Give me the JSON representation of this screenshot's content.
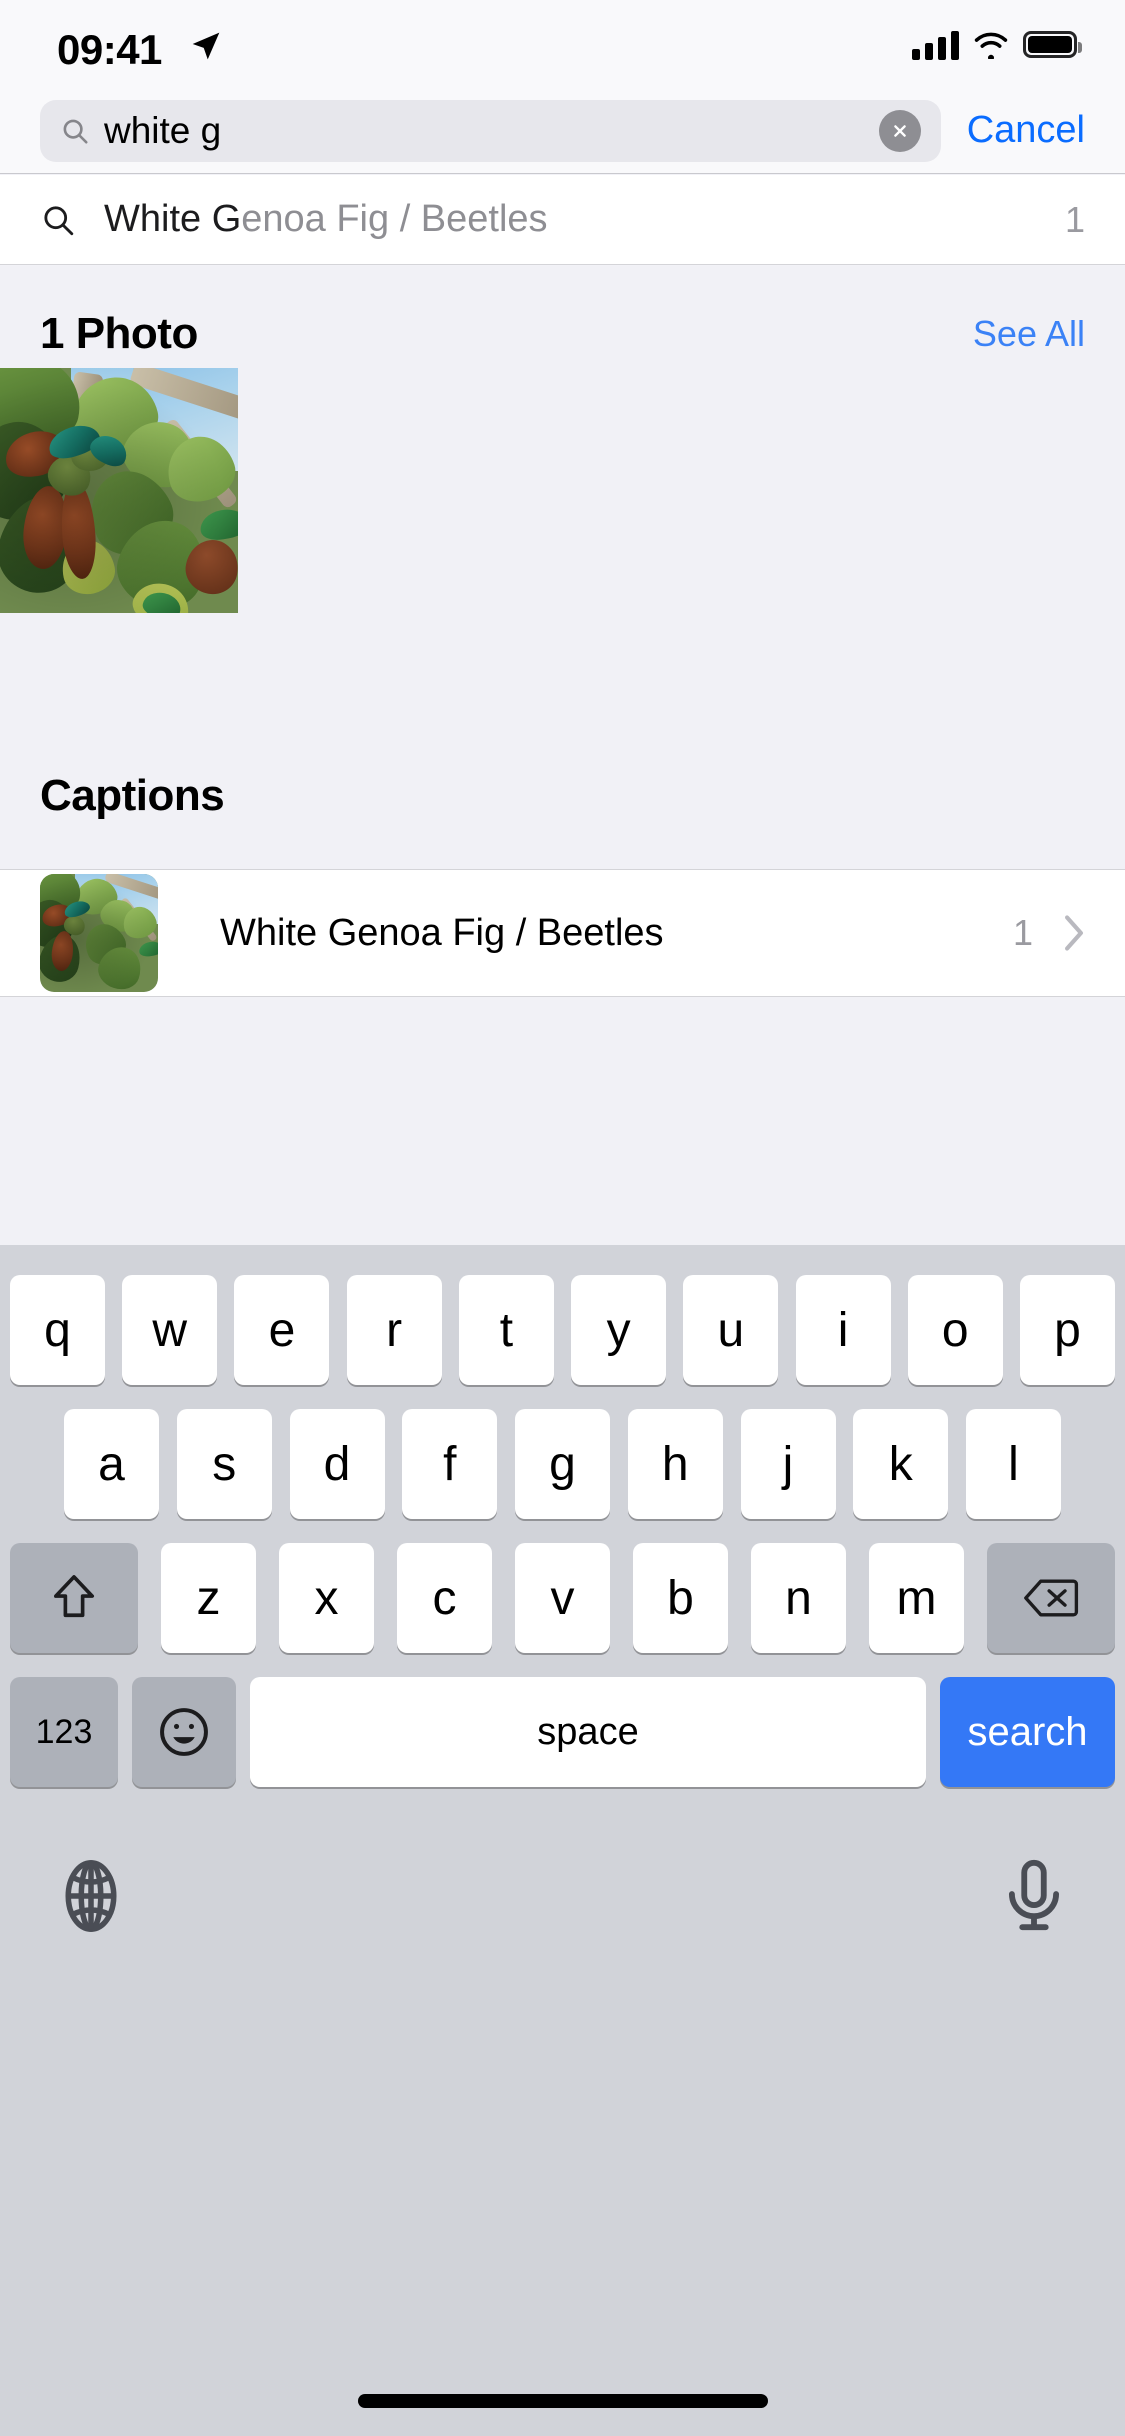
{
  "statusbar": {
    "time": "09:41",
    "location_icon": "location-arrow-icon",
    "cellular_icon": "cellular-bars-icon",
    "wifi_icon": "wifi-icon",
    "battery_icon": "battery-full-icon"
  },
  "search": {
    "icon": "search-icon",
    "value": "white g",
    "placeholder": "Search",
    "clear_icon": "clear-circle-icon",
    "cancel_label": "Cancel"
  },
  "suggestion": {
    "icon": "search-icon",
    "matched_text": "White G",
    "remaining_text": "enoa Fig / Beetles",
    "count": "1"
  },
  "photos_section": {
    "title": "1 Photo",
    "see_all_label": "See All",
    "thumbnail_alt": "fig-branch-with-beetles-photo"
  },
  "captions_section": {
    "title": "Captions",
    "rows": [
      {
        "thumbnail_alt": "fig-branch-with-beetles-thumbnail",
        "label": "White Genoa Fig / Beetles",
        "count": "1",
        "chevron_icon": "chevron-right-icon"
      }
    ]
  },
  "keyboard": {
    "row1": [
      "q",
      "w",
      "e",
      "r",
      "t",
      "y",
      "u",
      "i",
      "o",
      "p"
    ],
    "row2": [
      "a",
      "s",
      "d",
      "f",
      "g",
      "h",
      "j",
      "k",
      "l"
    ],
    "row3_letters": [
      "z",
      "x",
      "c",
      "v",
      "b",
      "n",
      "m"
    ],
    "shift_icon": "shift-arrow-icon",
    "delete_icon": "delete-backspace-icon",
    "numeric_label": "123",
    "emoji_icon": "emoji-smiley-icon",
    "space_label": "space",
    "return_label": "search",
    "globe_icon": "globe-icon",
    "mic_icon": "microphone-icon"
  },
  "colors": {
    "accent_blue": "#0a6cff",
    "link_blue": "#3b82f6",
    "return_key_blue": "#3478f6",
    "keyboard_bg": "#d1d3d9",
    "section_bg": "#f1f1f6",
    "secondary_text": "#8e8e93"
  }
}
